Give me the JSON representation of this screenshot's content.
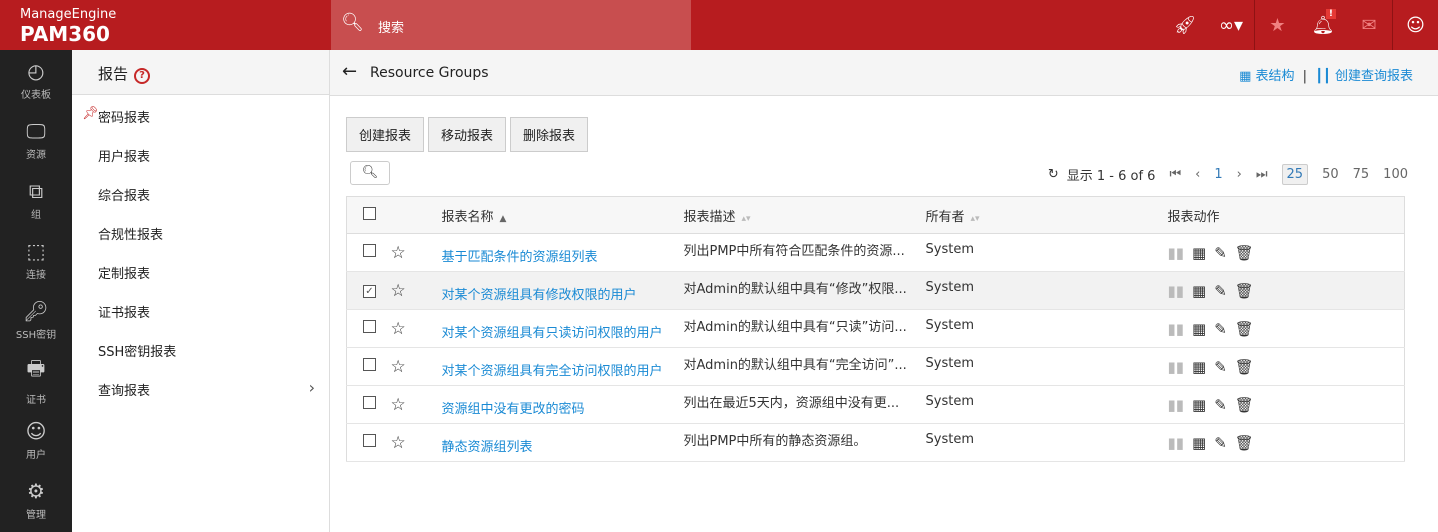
{
  "header": {
    "brand": "ManageEngine",
    "product": "PAM360",
    "search_placeholder": "搜索"
  },
  "rail": [
    {
      "icon": "dashboard-icon",
      "label": "仪表板"
    },
    {
      "icon": "resource-icon",
      "label": "资源"
    },
    {
      "icon": "group-icon",
      "label": "组"
    },
    {
      "icon": "connection-icon",
      "label": "连接"
    },
    {
      "icon": "ssh-key-icon",
      "label": "SSH密钥"
    },
    {
      "icon": "certificate-icon",
      "label": "证书"
    },
    {
      "icon": "user-icon",
      "label": "用户"
    },
    {
      "icon": "gear-icon",
      "label": "管理"
    }
  ],
  "sidebar": {
    "title": "报告",
    "items": [
      {
        "label": "密码报表"
      },
      {
        "label": "用户报表"
      },
      {
        "label": "综合报表"
      },
      {
        "label": "合规性报表"
      },
      {
        "label": "定制报表"
      },
      {
        "label": "证书报表"
      },
      {
        "label": "SSH密钥报表"
      },
      {
        "label": "查询报表"
      }
    ]
  },
  "main": {
    "title": "Resource Groups",
    "schema_link": "表结构",
    "create_query_link": "创建查询报表",
    "buttons": {
      "create": "创建报表",
      "move": "移动报表",
      "delete": "删除报表"
    },
    "pager": {
      "summary": "显示 1 - 6 of 6",
      "page": "1",
      "sizes": [
        "25",
        "50",
        "75",
        "100"
      ]
    },
    "columns": {
      "name": "报表名称",
      "desc": "报表描述",
      "owner": "所有者",
      "actions": "报表动作"
    },
    "rows": [
      {
        "name": "基于匹配条件的资源组列表",
        "desc": "列出PMP中所有符合匹配条件的资源...",
        "owner": "System",
        "checked": false
      },
      {
        "name": "对某个资源组具有修改权限的用户",
        "desc": "对Admin的默认组中具有“修改”权限...",
        "owner": "System",
        "checked": true
      },
      {
        "name": "对某个资源组具有只读访问权限的用户",
        "desc": "对Admin的默认组中具有“只读”访问...",
        "owner": "System",
        "checked": false
      },
      {
        "name": "对某个资源组具有完全访问权限的用户",
        "desc": "对Admin的默认组中具有“完全访问”...",
        "owner": "System",
        "checked": false
      },
      {
        "name": "资源组中没有更改的密码",
        "desc": "列出在最近5天内，资源组中没有更...",
        "owner": "System",
        "checked": false
      },
      {
        "name": "静态资源组列表",
        "desc": "列出PMP中所有的静态资源组。",
        "owner": "System",
        "checked": false
      }
    ]
  },
  "colors": {
    "brand": "#b71c1f",
    "link": "#1a8ad4"
  }
}
